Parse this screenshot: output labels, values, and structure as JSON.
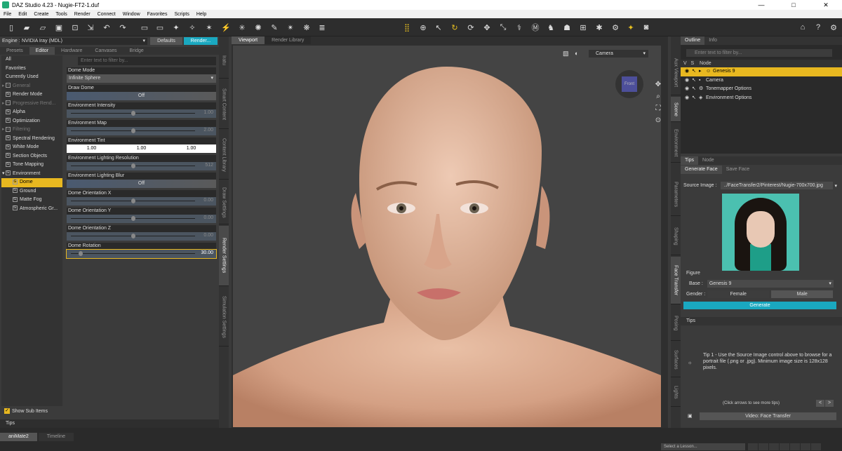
{
  "window": {
    "title": "DAZ Studio 4.23 - Nugie-FT2-1.duf",
    "minimize": "—",
    "maximize": "□",
    "close": "✕"
  },
  "menu": [
    "File",
    "Edit",
    "Create",
    "Tools",
    "Render",
    "Connect",
    "Window",
    "Favorites",
    "Scripts",
    "Help"
  ],
  "render_pane": {
    "engine_label": "Engine :",
    "engine_value": "NVIDIA Iray (MDL)",
    "defaults_button": "Defaults",
    "render_button": "Render...",
    "tabs": [
      "Presets",
      "Editor",
      "Hardware",
      "Canvases",
      "Bridge"
    ],
    "active_tab": "Editor",
    "categories": [
      {
        "label": "All"
      },
      {
        "label": "Favorites"
      },
      {
        "label": "Currently Used"
      },
      {
        "label": "General",
        "dim": true
      },
      {
        "label": "Render Mode"
      },
      {
        "label": "Progressive Rend...",
        "dim": true
      },
      {
        "label": "Alpha"
      },
      {
        "label": "Optimization"
      },
      {
        "label": "Filtering",
        "dim": true
      },
      {
        "label": "Spectral Rendering"
      },
      {
        "label": "White Mode"
      },
      {
        "label": "Section Objects"
      },
      {
        "label": "Tone Mapping"
      },
      {
        "label": "Environment"
      },
      {
        "label": "Dome",
        "selected": true
      },
      {
        "label": "Ground"
      },
      {
        "label": "Matte Fog"
      },
      {
        "label": "Atmospheric Gr..."
      }
    ],
    "filter_placeholder": "Enter text to filter by...",
    "properties": {
      "dome_mode": {
        "label": "Dome Mode",
        "value": "Infinite Sphere"
      },
      "draw_dome": {
        "label": "Draw Dome",
        "value": "Off"
      },
      "env_intensity": {
        "label": "Environment Intensity",
        "value": "1.00",
        "level": 0.5
      },
      "env_map": {
        "label": "Environment Map",
        "value": "2.00",
        "level": 0.5
      },
      "env_tint": {
        "label": "Environment Tint",
        "r": "1.00",
        "g": "1.00",
        "b": "1.00"
      },
      "env_light_res": {
        "label": "Environment Lighting Resolution",
        "value": "512",
        "level": 0.5
      },
      "env_light_blur": {
        "label": "Environment Lighting Blur",
        "value": "Off"
      },
      "dome_orient_x": {
        "label": "Dome Orientation X",
        "value": "0.00",
        "level": 0.5
      },
      "dome_orient_y": {
        "label": "Dome Orientation Y",
        "value": "0.00",
        "level": 0.5
      },
      "dome_orient_z": {
        "label": "Dome Orientation Z",
        "value": "0.00",
        "level": 0.5
      },
      "dome_rotation": {
        "label": "Dome Rotation",
        "value": "30.00",
        "level": 0.08
      }
    },
    "show_sub_items": "Show Sub Items",
    "tips": "Tips"
  },
  "left_vertical_tabs": [
    "Iratu",
    "Smart Content",
    "Content Library",
    "Draw Settings",
    "Render Settings",
    "Simulation Settings"
  ],
  "viewport": {
    "tabs": [
      "Viewport",
      "Render Library"
    ],
    "camera": "Camera",
    "navcube_label": "Front"
  },
  "right_vertical_tabs": [
    "Aux Viewport",
    "Scene",
    "Environment",
    "Parameters",
    "Shaping",
    "Face Transfer",
    "Posing",
    "Surfaces",
    "Lights"
  ],
  "scene_pane": {
    "tabs": [
      "Outline",
      "Info"
    ],
    "filter_placeholder": "Enter text to filter by...",
    "columns": [
      "V",
      "S",
      "Node"
    ],
    "nodes": [
      {
        "label": "Genesis 9",
        "selected": true
      },
      {
        "label": "Camera"
      },
      {
        "label": "Tonemapper Options"
      },
      {
        "label": "Environment Options"
      }
    ]
  },
  "tips_node_tabs": [
    "Tips",
    "Node"
  ],
  "face_transfer": {
    "tabs": [
      "Generate Face",
      "Save Face"
    ],
    "source_label": "Source Image :",
    "source_value": "../FaceTransfer2/Pinterest/Nugie-700x700.jpg",
    "figure_label": "Figure",
    "base_label": "Base :",
    "base_value": "Genesis 9",
    "gender_label": "Gender :",
    "female": "Female",
    "male": "Male",
    "generate": "Generate"
  },
  "tips_panel": {
    "title": "Tips",
    "text": "Tip 1 - Use the Source Image control above to browse for a portrait file (.png or .jpg). Minimum image size is 128x128 pixels.",
    "nav_hint": "(Click arrows to see more tips)",
    "prev": "<",
    "next": ">",
    "video_button": "Video: Face Transfer"
  },
  "bottom": {
    "tabs": [
      "aniMate2",
      "Timeline"
    ],
    "lesson_placeholder": "Select a Lesson..."
  }
}
